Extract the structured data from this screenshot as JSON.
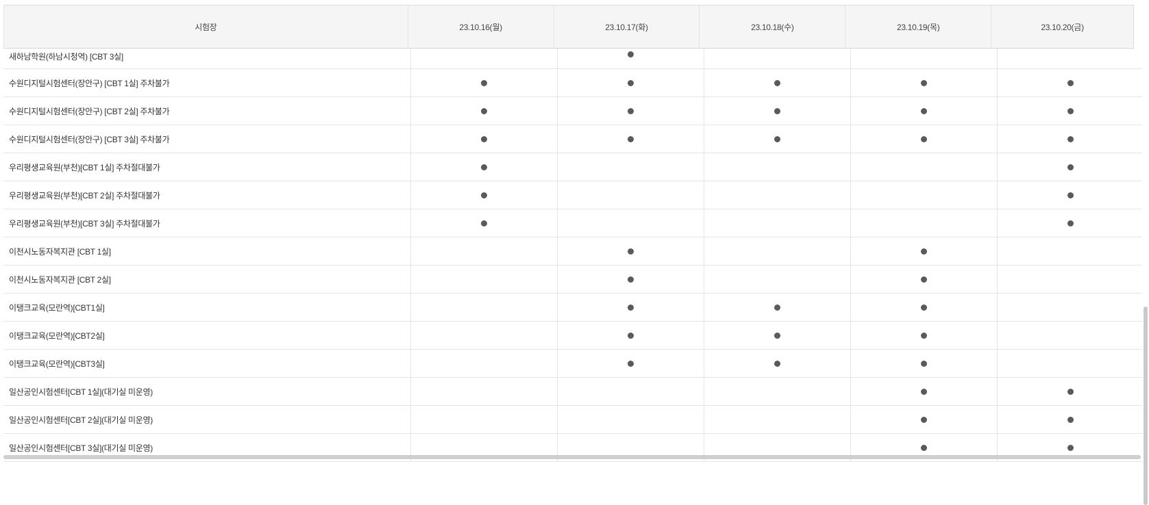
{
  "table": {
    "header": {
      "venue": "시험장",
      "dates": [
        "23.10.16(월)",
        "23.10.17(화)",
        "23.10.18(수)",
        "23.10.19(목)",
        "23.10.20(금)"
      ]
    },
    "rows": [
      {
        "name": "새하남학원(하남시청역) [CBT 3실]",
        "days": [
          0,
          1,
          0,
          0,
          0
        ]
      },
      {
        "name": "수원디지털시험센터(장안구) [CBT 1실] 주차불가",
        "days": [
          1,
          1,
          1,
          1,
          1
        ]
      },
      {
        "name": "수원디지털시험센터(장안구) [CBT 2실] 주차불가",
        "days": [
          1,
          1,
          1,
          1,
          1
        ]
      },
      {
        "name": "수원디지털시험센터(장안구) [CBT 3실] 주차불가",
        "days": [
          1,
          1,
          1,
          1,
          1
        ]
      },
      {
        "name": "우리평생교육원(부천)[CBT 1실] 주차절대불가",
        "days": [
          1,
          0,
          0,
          0,
          1
        ]
      },
      {
        "name": "우리평생교육원(부천)[CBT 2실] 주차절대불가",
        "days": [
          1,
          0,
          0,
          0,
          1
        ]
      },
      {
        "name": "우리평생교육원(부천)[CBT 3실] 주차절대불가",
        "days": [
          1,
          0,
          0,
          0,
          1
        ]
      },
      {
        "name": "이천시노동자복지관 [CBT 1실]",
        "days": [
          0,
          1,
          0,
          1,
          0
        ]
      },
      {
        "name": "이천시노동자복지관 [CBT 2실]",
        "days": [
          0,
          1,
          0,
          1,
          0
        ]
      },
      {
        "name": "이탱크교육(모란역)[CBT1실]",
        "days": [
          0,
          1,
          1,
          1,
          0
        ]
      },
      {
        "name": "이탱크교육(모란역)[CBT2실]",
        "days": [
          0,
          1,
          1,
          1,
          0
        ]
      },
      {
        "name": "이탱크교육(모란역)[CBT3실]",
        "days": [
          0,
          1,
          1,
          1,
          0
        ]
      },
      {
        "name": "일산공인시험센터[CBT 1실](대기실 미운영)",
        "days": [
          0,
          0,
          0,
          1,
          1
        ]
      },
      {
        "name": "일산공인시험센터[CBT 2실](대기실 미운영)",
        "days": [
          0,
          0,
          0,
          1,
          1
        ]
      },
      {
        "name": "일산공인시험센터[CBT 3실](대기실 미운영)",
        "days": [
          0,
          0,
          0,
          1,
          1
        ]
      }
    ],
    "dot_icon": "filled-circle-icon",
    "colors": {
      "dot": "#5a5a5a",
      "header_bg": "#f5f5f5",
      "border": "#e4e4e4"
    }
  }
}
